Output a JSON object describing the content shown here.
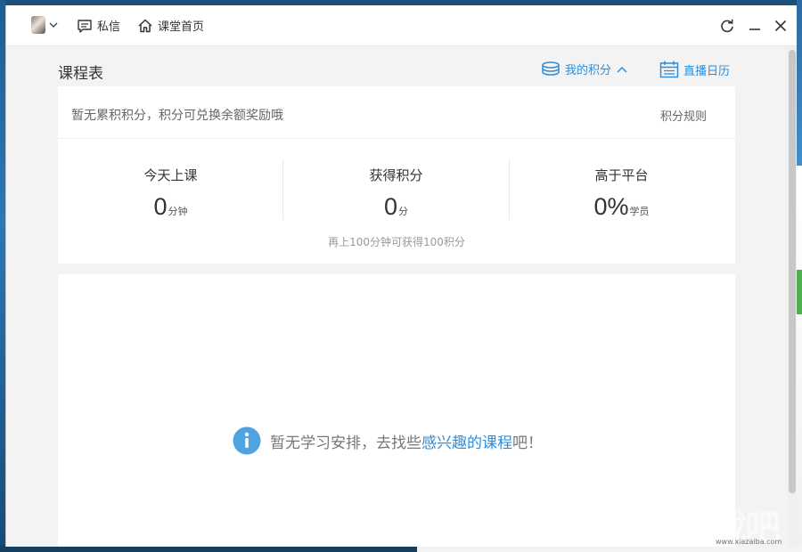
{
  "titlebar": {
    "messages_label": "私信",
    "home_label": "课堂首页"
  },
  "page": {
    "title": "课程表",
    "my_points_label": "我的积分",
    "live_calendar_label": "直播日历"
  },
  "points": {
    "hint": "暂无累积积分，积分可兑换余额奖励哦",
    "rules_label": "积分规则",
    "stats": [
      {
        "label": "今天上课",
        "value": "0",
        "unit": "分钟"
      },
      {
        "label": "获得积分",
        "value": "0",
        "unit": "分"
      },
      {
        "label": "高于平台",
        "value": "0%",
        "unit": "学员"
      }
    ],
    "footer": "再上100分钟可获得100积分"
  },
  "course": {
    "empty_prefix": "暂无学习安排，去找些",
    "empty_link": "感兴趣的课程",
    "empty_suffix": "吧！"
  },
  "colors": {
    "accent": "#2f8dd8",
    "info_icon": "#4fa3e0"
  },
  "watermark": {
    "text": "下载吧",
    "sub": "www.xiazaiba.com"
  }
}
